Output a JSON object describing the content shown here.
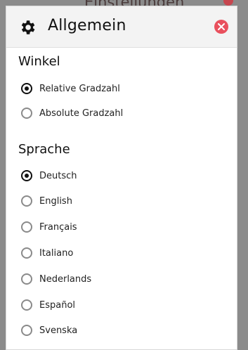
{
  "backdrop": {
    "title": "Einstellungen"
  },
  "panel": {
    "title": "Allgemein",
    "gear_icon": "gear-icon",
    "close_icon": "close-icon",
    "colors": {
      "close": "#e9505d",
      "text": "#111111"
    }
  },
  "sections": [
    {
      "title": "Winkel",
      "options": [
        {
          "label": "Relative Gradzahl",
          "checked": true
        },
        {
          "label": "Absolute Gradzahl",
          "checked": false
        }
      ]
    },
    {
      "title": "Sprache",
      "options": [
        {
          "label": "Deutsch",
          "checked": true
        },
        {
          "label": "English",
          "checked": false
        },
        {
          "label": "Français",
          "checked": false
        },
        {
          "label": "Italiano",
          "checked": false
        },
        {
          "label": "Nederlands",
          "checked": false
        },
        {
          "label": "Español",
          "checked": false
        },
        {
          "label": "Svenska",
          "checked": false
        }
      ]
    }
  ]
}
